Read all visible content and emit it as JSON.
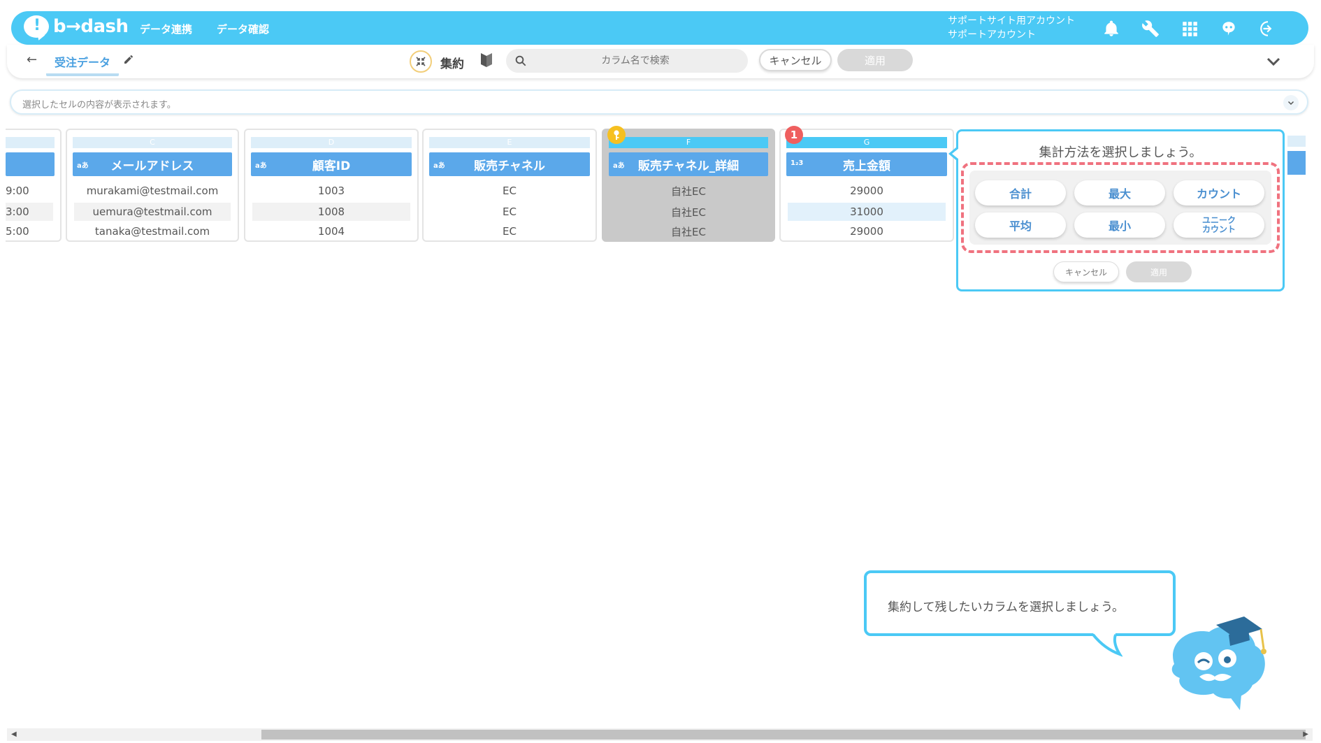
{
  "header": {
    "logo_mark": "!",
    "logo_text": "b→dash",
    "nav": [
      "データ連携",
      "データ確認"
    ],
    "account_line1": "サポートサイト用アカウント",
    "account_line2": "サポートアカウント",
    "icons": [
      "bell-icon",
      "wrench-icon",
      "apps-grid-icon",
      "mascot-chat-icon",
      "logout-icon"
    ],
    "accent_color": "#4bc9f5"
  },
  "toolbar": {
    "back": "←",
    "title": "受注データ",
    "mode_label": "集約",
    "search_placeholder": "カラム名で検索",
    "cancel_label": "キャンセル",
    "apply_label": "適用"
  },
  "cellbar": {
    "placeholder": "選択したセルの内容が表示されます。"
  },
  "columns": {
    "partial": {
      "cells": [
        "9:00",
        "3:00",
        "5:00"
      ]
    },
    "c": {
      "letter": "C",
      "type": "aあ",
      "name": "メールアドレス",
      "cells": [
        "murakami@testmail.com",
        "uemura@testmail.com",
        "tanaka@testmail.com"
      ]
    },
    "d": {
      "letter": "D",
      "type": "aあ",
      "name": "顧客ID",
      "cells": [
        "1003",
        "1008",
        "1004"
      ]
    },
    "e": {
      "letter": "E",
      "type": "aあ",
      "name": "販売チャネル",
      "cells": [
        "EC",
        "EC",
        "EC"
      ]
    },
    "f": {
      "letter": "F",
      "type": "aあ",
      "name": "販売チャネル_詳細",
      "cells": [
        "自社EC",
        "自社EC",
        "自社EC"
      ],
      "selected": true
    },
    "g": {
      "letter": "G",
      "type": "1₂3",
      "name": "売上金額",
      "cells": [
        "29000",
        "31000",
        "29000"
      ],
      "badge": "1"
    }
  },
  "aggregation_popup": {
    "title": "集計方法を選択しましょう。",
    "methods": [
      "合計",
      "最大",
      "カウント",
      "平均",
      "最小",
      "ユニーク\nカウント"
    ],
    "cancel_label": "キャンセル",
    "apply_label": "適用",
    "highlight_color": "#f0727f"
  },
  "hint": {
    "text": "集約して残したいカラムを選択しましょう。"
  }
}
